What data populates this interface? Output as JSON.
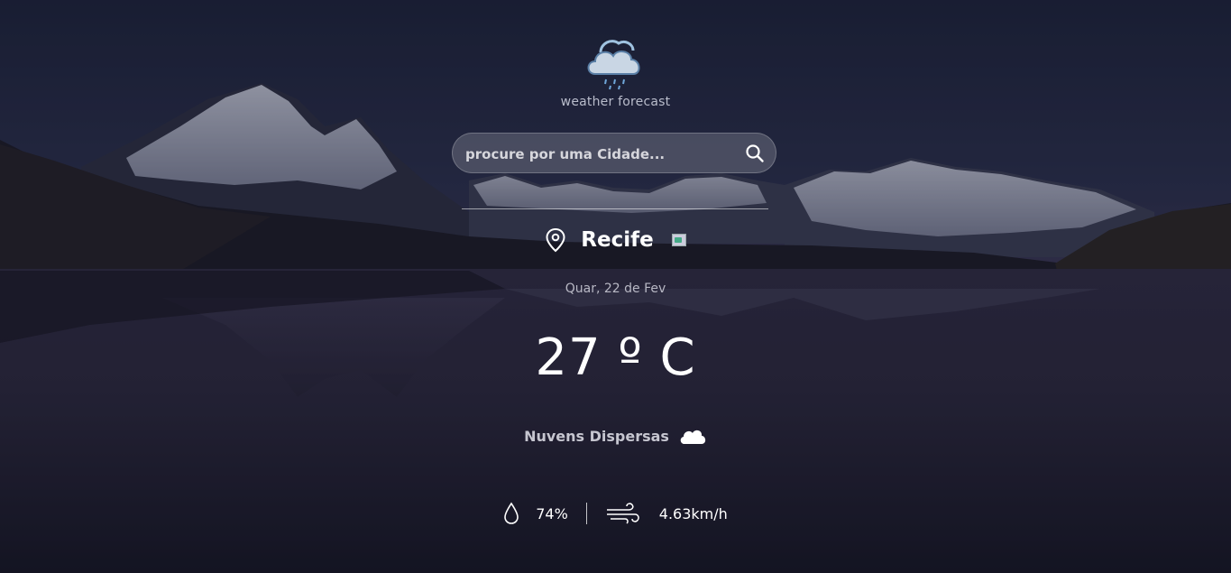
{
  "app": {
    "title": "weather forecast"
  },
  "search": {
    "placeholder": "procure por uma Cidade...",
    "value": ""
  },
  "location": {
    "city": "Recife"
  },
  "date": "Quar, 22 de Fev",
  "weather": {
    "temperature": "27 º C",
    "description": "Nuvens Dispersas",
    "humidity": "74%",
    "wind": "4.63km/h"
  },
  "icons": {
    "logo": "cloud-rain-icon",
    "search": "search-icon",
    "location": "map-pin-icon",
    "flag": "country-flag-icon",
    "condition": "cloud-icon",
    "humidity": "water-drop-icon",
    "wind": "wind-icon"
  },
  "colors": {
    "sky": "#1e2236",
    "water": "#231f30",
    "text": "#ffffff",
    "muted": "#b9bccb"
  }
}
